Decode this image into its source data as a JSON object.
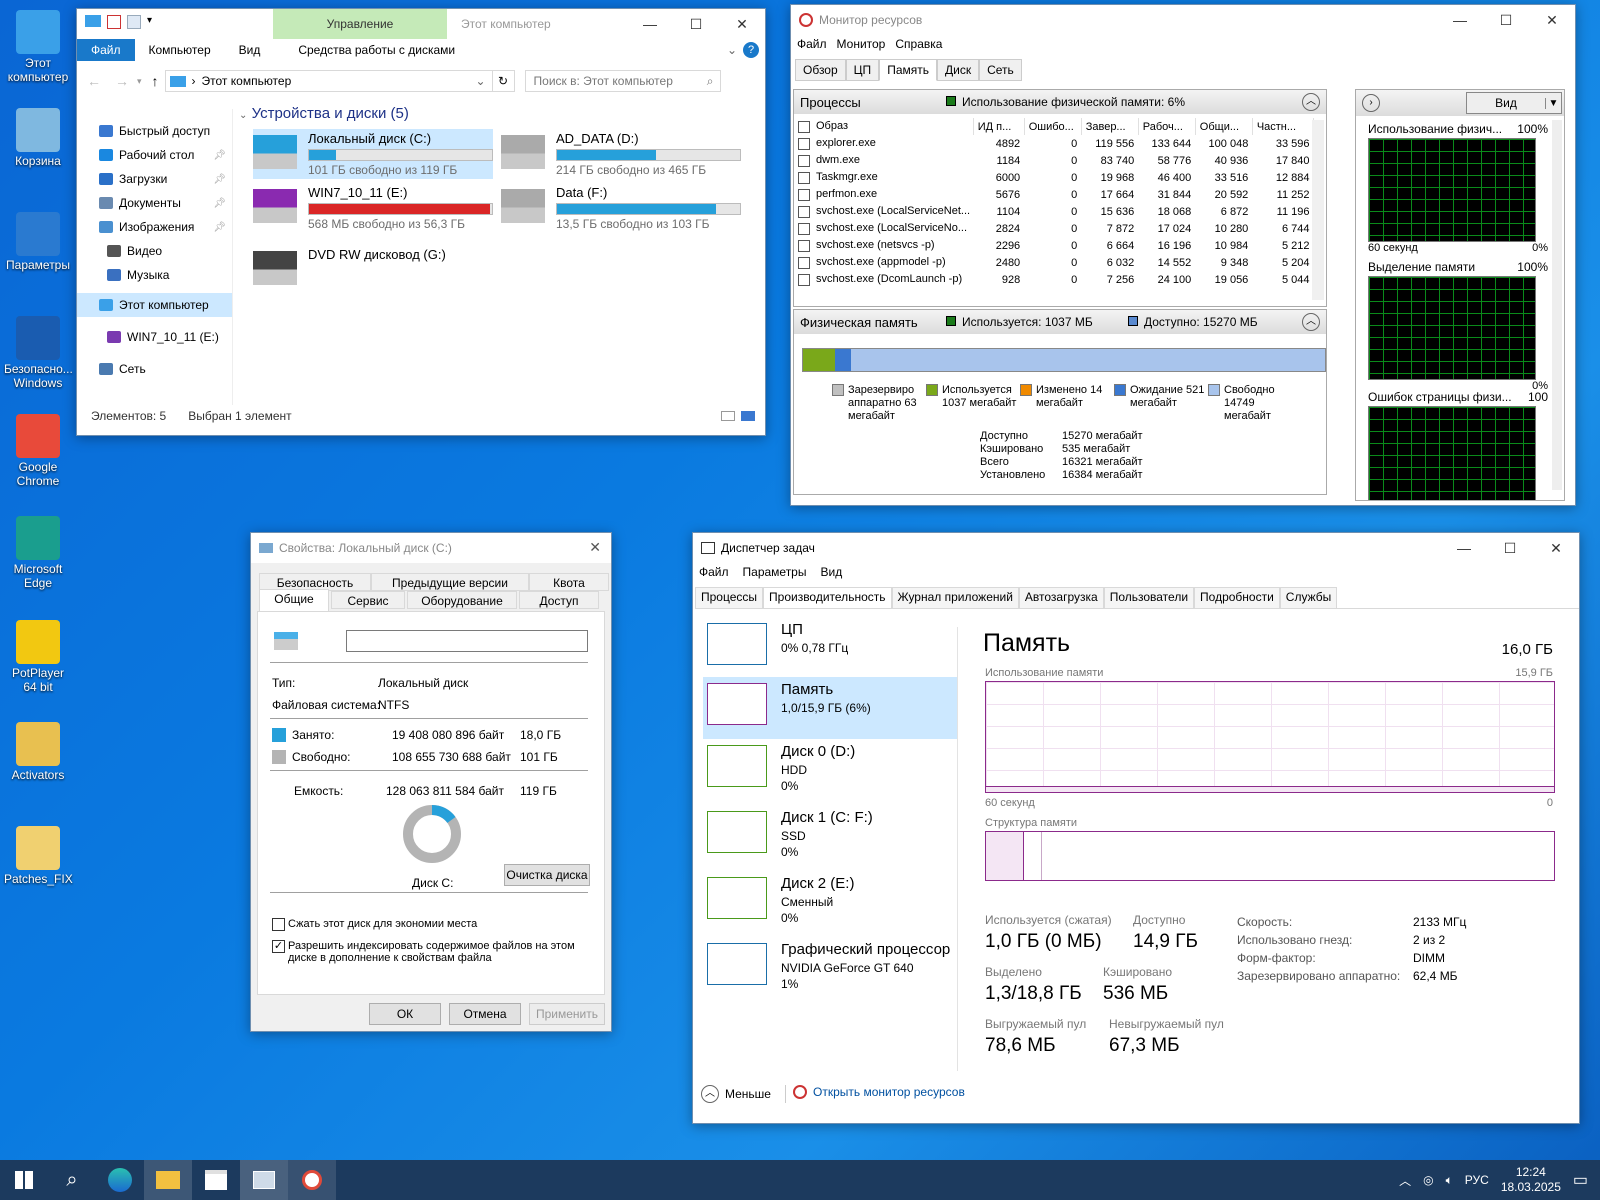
{
  "desktop": {
    "icons": [
      {
        "label": "Этот компьютер",
        "color": "#3aa0e8"
      },
      {
        "label": "Корзина",
        "color": "#7fb8e0"
      },
      {
        "label": "Параметры",
        "color": "#2a7ad0"
      },
      {
        "label": "Безопасно... Windows",
        "color": "#1a5cb0"
      },
      {
        "label": "Google Chrome",
        "color": "#e84a3a"
      },
      {
        "label": "Microsoft Edge",
        "color": "#1a9e8e"
      },
      {
        "label": "PotPlayer 64 bit",
        "color": "#f2c811"
      },
      {
        "label": "Activators",
        "color": "#e8c050"
      },
      {
        "label": "Patches_FIX",
        "color": "#f0d070"
      }
    ]
  },
  "explorer": {
    "title": "Этот компьютер",
    "ribbon_context": "Управление",
    "ribbon_context_sub": "Средства работы с дисками",
    "tabs": [
      "Файл",
      "Компьютер",
      "Вид"
    ],
    "address": "Этот компьютер",
    "search_placeholder": "Поиск в: Этот компьютер",
    "section": "Устройства и диски (5)",
    "sidebar": [
      {
        "label": "Быстрый доступ",
        "pin": false
      },
      {
        "label": "Рабочий стол",
        "pin": true
      },
      {
        "label": "Загрузки",
        "pin": true
      },
      {
        "label": "Документы",
        "pin": true
      },
      {
        "label": "Изображения",
        "pin": true
      },
      {
        "label": "Видео",
        "pin": false
      },
      {
        "label": "Музыка",
        "pin": false
      },
      {
        "label": "Этот компьютер",
        "pin": false
      },
      {
        "label": "WIN7_10_11 (E:)",
        "pin": false
      },
      {
        "label": "Сеть",
        "pin": false
      }
    ],
    "drives": [
      {
        "name": "Локальный диск (C:)",
        "free": "101 ГБ свободно из 119 ГБ",
        "used_fraction": 0.15,
        "color": "#26a0da"
      },
      {
        "name": "AD_DATA (D:)",
        "free": "214 ГБ свободно из 465 ГБ",
        "used_fraction": 0.54,
        "color": "#26a0da"
      },
      {
        "name": "WIN7_10_11 (E:)",
        "free": "568 МБ свободно из 56,3 ГБ",
        "used_fraction": 0.99,
        "color": "#da2626"
      },
      {
        "name": "Data (F:)",
        "free": "13,5 ГБ свободно из 103 ГБ",
        "used_fraction": 0.87,
        "color": "#26a0da"
      },
      {
        "name": "DVD RW дисковод (G:)",
        "free": "",
        "used_fraction": null,
        "color": ""
      }
    ],
    "status_count": "Элементов: 5",
    "status_selected": "Выбран 1 элемент"
  },
  "resmon": {
    "title": "Монитор ресурсов",
    "menu": [
      "Файл",
      "Монитор",
      "Справка"
    ],
    "tabs": [
      "Обзор",
      "ЦП",
      "Память",
      "Диск",
      "Сеть"
    ],
    "proc_header": "Процессы",
    "proc_usage": "Использование физической памяти: 6%",
    "columns": [
      "Образ",
      "ИД п...",
      "Ошибо...",
      "Завер...",
      "Рабоч...",
      "Общи...",
      "Частн..."
    ],
    "rows": [
      [
        "explorer.exe",
        "4892",
        "0",
        "119 556",
        "133 644",
        "100 048",
        "33 596"
      ],
      [
        "dwm.exe",
        "1184",
        "0",
        "83 740",
        "58 776",
        "40 936",
        "17 840"
      ],
      [
        "Taskmgr.exe",
        "6000",
        "0",
        "19 968",
        "46 400",
        "33 516",
        "12 884"
      ],
      [
        "perfmon.exe",
        "5676",
        "0",
        "17 664",
        "31 844",
        "20 592",
        "11 252"
      ],
      [
        "svchost.exe (LocalServiceNet...",
        "1104",
        "0",
        "15 636",
        "18 068",
        "6 872",
        "11 196"
      ],
      [
        "svchost.exe (LocalServiceNo...",
        "2824",
        "0",
        "7 872",
        "17 024",
        "10 280",
        "6 744"
      ],
      [
        "svchost.exe (netsvcs -p)",
        "2296",
        "0",
        "6 664",
        "16 196",
        "10 984",
        "5 212"
      ],
      [
        "svchost.exe (appmodel -p)",
        "2480",
        "0",
        "6 032",
        "14 552",
        "9 348",
        "5 204"
      ],
      [
        "svchost.exe (DcomLaunch -p)",
        "928",
        "0",
        "7 256",
        "24 100",
        "19 056",
        "5 044"
      ]
    ],
    "phys_header": "Физическая память",
    "phys_used": "Используется: 1037 МБ",
    "phys_avail": "Доступно: 15270 МБ",
    "legend": [
      {
        "label": "Зарезервиро аппаратно 63 мегабайт",
        "color": "#c0c0c0"
      },
      {
        "label": "Используется 1037 мегабайт",
        "color": "#7aa81a"
      },
      {
        "label": "Изменено 14 мегабайт",
        "color": "#f08a00"
      },
      {
        "label": "Ожидание 521 мегабайт",
        "color": "#3a78d0"
      },
      {
        "label": "Свободно 14749 мегабайт",
        "color": "#a8c4ec"
      }
    ],
    "stats": [
      {
        "k": "Доступно",
        "v": "15270 мегабайт"
      },
      {
        "k": "Кэшировано",
        "v": "535 мегабайт"
      },
      {
        "k": "Всего",
        "v": "16321 мегабайт"
      },
      {
        "k": "Установлено",
        "v": "16384 мегабайт"
      }
    ],
    "view_label": "Вид",
    "graphs": [
      {
        "title": "Использование физич...",
        "max": "100%",
        "foot_l": "60 секунд",
        "foot_r": "0%"
      },
      {
        "title": "Выделение памяти",
        "max": "100%",
        "foot_l": "",
        "foot_r": "0%"
      },
      {
        "title": "Ошибок страницы физи...",
        "max": "100",
        "foot_l": "",
        "foot_r": ""
      }
    ]
  },
  "props": {
    "title": "Свойства: Локальный диск (C:)",
    "tabs_top": [
      "Безопасность",
      "Предыдущие версии",
      "Квота"
    ],
    "tabs_bottom": [
      "Общие",
      "Сервис",
      "Оборудование",
      "Доступ"
    ],
    "type_k": "Тип:",
    "type_v": "Локальный диск",
    "fs_k": "Файловая система:",
    "fs_v": "NTFS",
    "used_k": "Занято:",
    "used_b": "19 408 080 896 байт",
    "used_g": "18,0 ГБ",
    "free_k": "Свободно:",
    "free_b": "108 655 730 688 байт",
    "free_g": "101 ГБ",
    "cap_k": "Емкость:",
    "cap_b": "128 063 811 584 байт",
    "cap_g": "119 ГБ",
    "used_fraction": 0.15,
    "disk_label": "Диск С:",
    "cleanup": "Очистка диска",
    "cb1": "Сжать этот диск для экономии места",
    "cb2": "Разрешить индексировать содержимое файлов на этом диске в дополнение к свойствам файла",
    "ok": "ОК",
    "cancel": "Отмена",
    "apply": "Применить"
  },
  "taskmgr": {
    "title": "Диспетчер задач",
    "menu": [
      "Файл",
      "Параметры",
      "Вид"
    ],
    "tabs": [
      "Процессы",
      "Производительность",
      "Журнал приложений",
      "Автозагрузка",
      "Пользователи",
      "Подробности",
      "Службы"
    ],
    "side": [
      {
        "t1": "ЦП",
        "t2": "0% 0,78 ГГц",
        "t3": "",
        "color": "#1a6ea8"
      },
      {
        "t1": "Память",
        "t2": "1,0/15,9 ГБ (6%)",
        "t3": "",
        "color": "#8b2a8b"
      },
      {
        "t1": "Диск 0 (D:)",
        "t2": "HDD",
        "t3": "0%",
        "color": "#4a9a1a"
      },
      {
        "t1": "Диск 1 (C: F:)",
        "t2": "SSD",
        "t3": "0%",
        "color": "#4a9a1a"
      },
      {
        "t1": "Диск 2 (E:)",
        "t2": "Сменный",
        "t3": "0%",
        "color": "#4a9a1a"
      },
      {
        "t1": "Графический процессор",
        "t2": "NVIDIA GeForce GT 640",
        "t3": "1%",
        "color": "#1a6ea8"
      }
    ],
    "heading": "Память",
    "total": "16,0 ГБ",
    "usage_label": "Использование памяти",
    "usage_max": "15,9 ГБ",
    "g_left": "60 секунд",
    "g_right": "0",
    "struct_label": "Структура памяти",
    "stats": [
      {
        "k": "Используется (сжатая)",
        "v": "1,0 ГБ (0 МБ)"
      },
      {
        "k": "Доступно",
        "v": "14,9 ГБ"
      },
      {
        "k": "Выделено",
        "v": "1,3/18,8 ГБ"
      },
      {
        "k": "Кэшировано",
        "v": "536 МБ"
      },
      {
        "k": "Выгружаемый пул",
        "v": "78,6 МБ"
      },
      {
        "k": "Невыгружаемый пул",
        "v": "67,3 МБ"
      }
    ],
    "right": [
      {
        "k": "Скорость:",
        "v": "2133 МГц"
      },
      {
        "k": "Использовано гнезд:",
        "v": "2 из 2"
      },
      {
        "k": "Форм-фактор:",
        "v": "DIMM"
      },
      {
        "k": "Зарезервировано аппаратно:",
        "v": "62,4 МБ"
      }
    ],
    "less": "Меньше",
    "open_resmon": "Открыть монитор ресурсов"
  },
  "taskbar": {
    "lang": "РУС",
    "time": "12:24",
    "date": "18.03.2025"
  }
}
